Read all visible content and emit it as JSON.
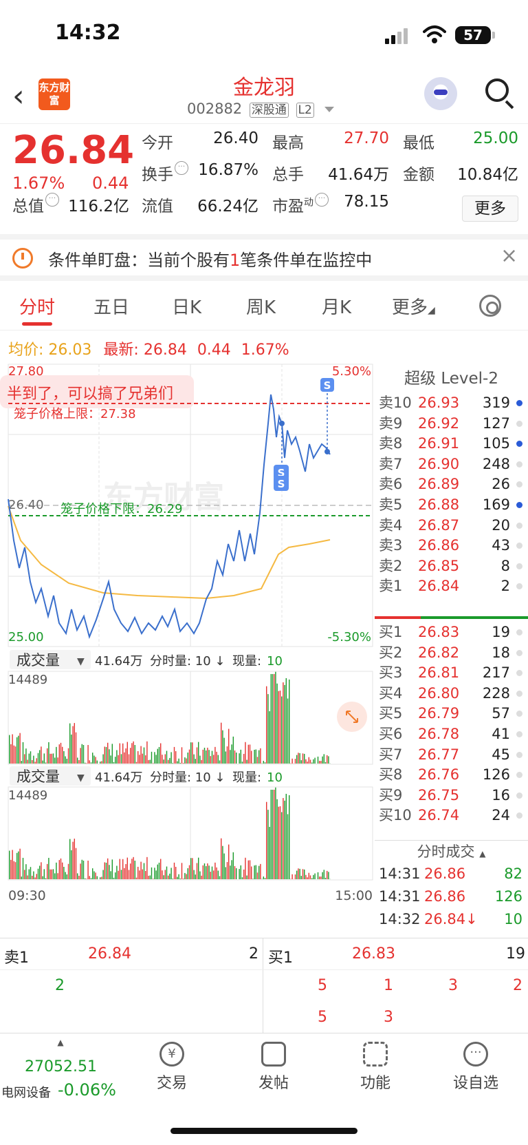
{
  "status": {
    "time": "14:32",
    "battery": "57"
  },
  "nav": {
    "back_icon": "chevron-left",
    "logo_text": "东方财富",
    "title": "金龙羽",
    "code": "002882",
    "tag1": "深股通",
    "tag2": "L2"
  },
  "quote": {
    "price": "26.84",
    "pct": "1.67%",
    "chg": "0.44",
    "open_l": "今开",
    "open_v": "26.40",
    "high_l": "最高",
    "high_v": "27.70",
    "low_l": "最低",
    "low_v": "25.00",
    "turn_l": "换手",
    "turn_v": "16.87%",
    "vol_l": "总手",
    "vol_v": "41.64万",
    "amt_l": "金额",
    "amt_v": "10.84亿",
    "cap_l": "总值",
    "cap_v": "116.2亿",
    "fcap_l": "流值",
    "fcap_v": "66.24亿",
    "pe_l": "市盈",
    "pe_sup": "动",
    "pe_v": "78.15",
    "more": "更多"
  },
  "alert": {
    "prefix": "条件单盯盘：当前个股有",
    "count": "1",
    "suffix": "笔条件单在监控中",
    "close": "×"
  },
  "tabs": [
    "分时",
    "五日",
    "日K",
    "周K",
    "月K",
    "更多"
  ],
  "avgline": {
    "avg_l": "均价:",
    "avg_v": "26.03",
    "last_l": "最新:",
    "last_v": "26.84",
    "chg": "0.44",
    "pct": "1.67%"
  },
  "chart": {
    "ymax": "27.80",
    "ymid": "26.40",
    "ymin": "25.00",
    "pmax": "5.30%",
    "pmin": "-5.30%",
    "upper_label": "笼子价格上限：27.38",
    "lower_label": "笼子价格下限：26.29",
    "note": "半到了，可以搞了兄弟们",
    "watermark": "东方财富",
    "vol_head1": {
      "sel": "成交量",
      "total": "41.64万",
      "seg": "分时量: 10 ↓",
      "cur_l": "现量:",
      "cur_v": "10"
    },
    "vol_head2": {
      "sel": "成交量",
      "total": "41.64万",
      "seg": "分时量: 10 ↓",
      "cur_l": "现量:",
      "cur_v": "10"
    },
    "vol_max1": "14489",
    "vol_max2": "14489",
    "t_start": "09:30",
    "t_end": "15:00"
  },
  "book": {
    "title": "超级 Level-2",
    "asks": [
      {
        "l": "卖10",
        "p": "26.93",
        "v": "319",
        "dot": "blue"
      },
      {
        "l": "卖9",
        "p": "26.92",
        "v": "127",
        "dot": "gray"
      },
      {
        "l": "卖8",
        "p": "26.91",
        "v": "105",
        "dot": "blue"
      },
      {
        "l": "卖7",
        "p": "26.90",
        "v": "248",
        "dot": "gray"
      },
      {
        "l": "卖6",
        "p": "26.89",
        "v": "26",
        "dot": "gray"
      },
      {
        "l": "卖5",
        "p": "26.88",
        "v": "169",
        "dot": "blue"
      },
      {
        "l": "卖4",
        "p": "26.87",
        "v": "20",
        "dot": "gray"
      },
      {
        "l": "卖3",
        "p": "26.86",
        "v": "43",
        "dot": "gray"
      },
      {
        "l": "卖2",
        "p": "26.85",
        "v": "8",
        "dot": "gray"
      },
      {
        "l": "卖1",
        "p": "26.84",
        "v": "2",
        "dot": "gray"
      }
    ],
    "bids": [
      {
        "l": "买1",
        "p": "26.83",
        "v": "19",
        "dot": "gray"
      },
      {
        "l": "买2",
        "p": "26.82",
        "v": "18",
        "dot": "gray"
      },
      {
        "l": "买3",
        "p": "26.81",
        "v": "217",
        "dot": "gray"
      },
      {
        "l": "买4",
        "p": "26.80",
        "v": "228",
        "dot": "gray"
      },
      {
        "l": "买5",
        "p": "26.79",
        "v": "57",
        "dot": "gray"
      },
      {
        "l": "买6",
        "p": "26.78",
        "v": "41",
        "dot": "gray"
      },
      {
        "l": "买7",
        "p": "26.77",
        "v": "45",
        "dot": "gray"
      },
      {
        "l": "买8",
        "p": "26.76",
        "v": "126",
        "dot": "gray"
      },
      {
        "l": "买9",
        "p": "26.75",
        "v": "16",
        "dot": "gray"
      },
      {
        "l": "买10",
        "p": "26.74",
        "v": "24",
        "dot": "gray"
      }
    ],
    "trades_title": "分时成交",
    "trades": [
      {
        "t": "14:31",
        "p": "26.86",
        "v": "82"
      },
      {
        "t": "14:31",
        "p": "26.86",
        "v": "126"
      },
      {
        "t": "14:32",
        "p": "26.84↓",
        "v": "10"
      }
    ]
  },
  "level1": {
    "sell_l": "卖1",
    "sell_p": "26.84",
    "sell_v": "2",
    "buy_l": "买1",
    "buy_p": "26.83",
    "buy_v": "19",
    "sell_q": [
      "2"
    ],
    "buy_q": [
      "5",
      "1",
      "3",
      "2",
      "5",
      "3"
    ]
  },
  "footer": {
    "index_v": "27052.51",
    "index_name": "电网设备",
    "index_pct": "-0.06%",
    "items": [
      "交易",
      "发帖",
      "功能",
      "设自选"
    ]
  }
}
